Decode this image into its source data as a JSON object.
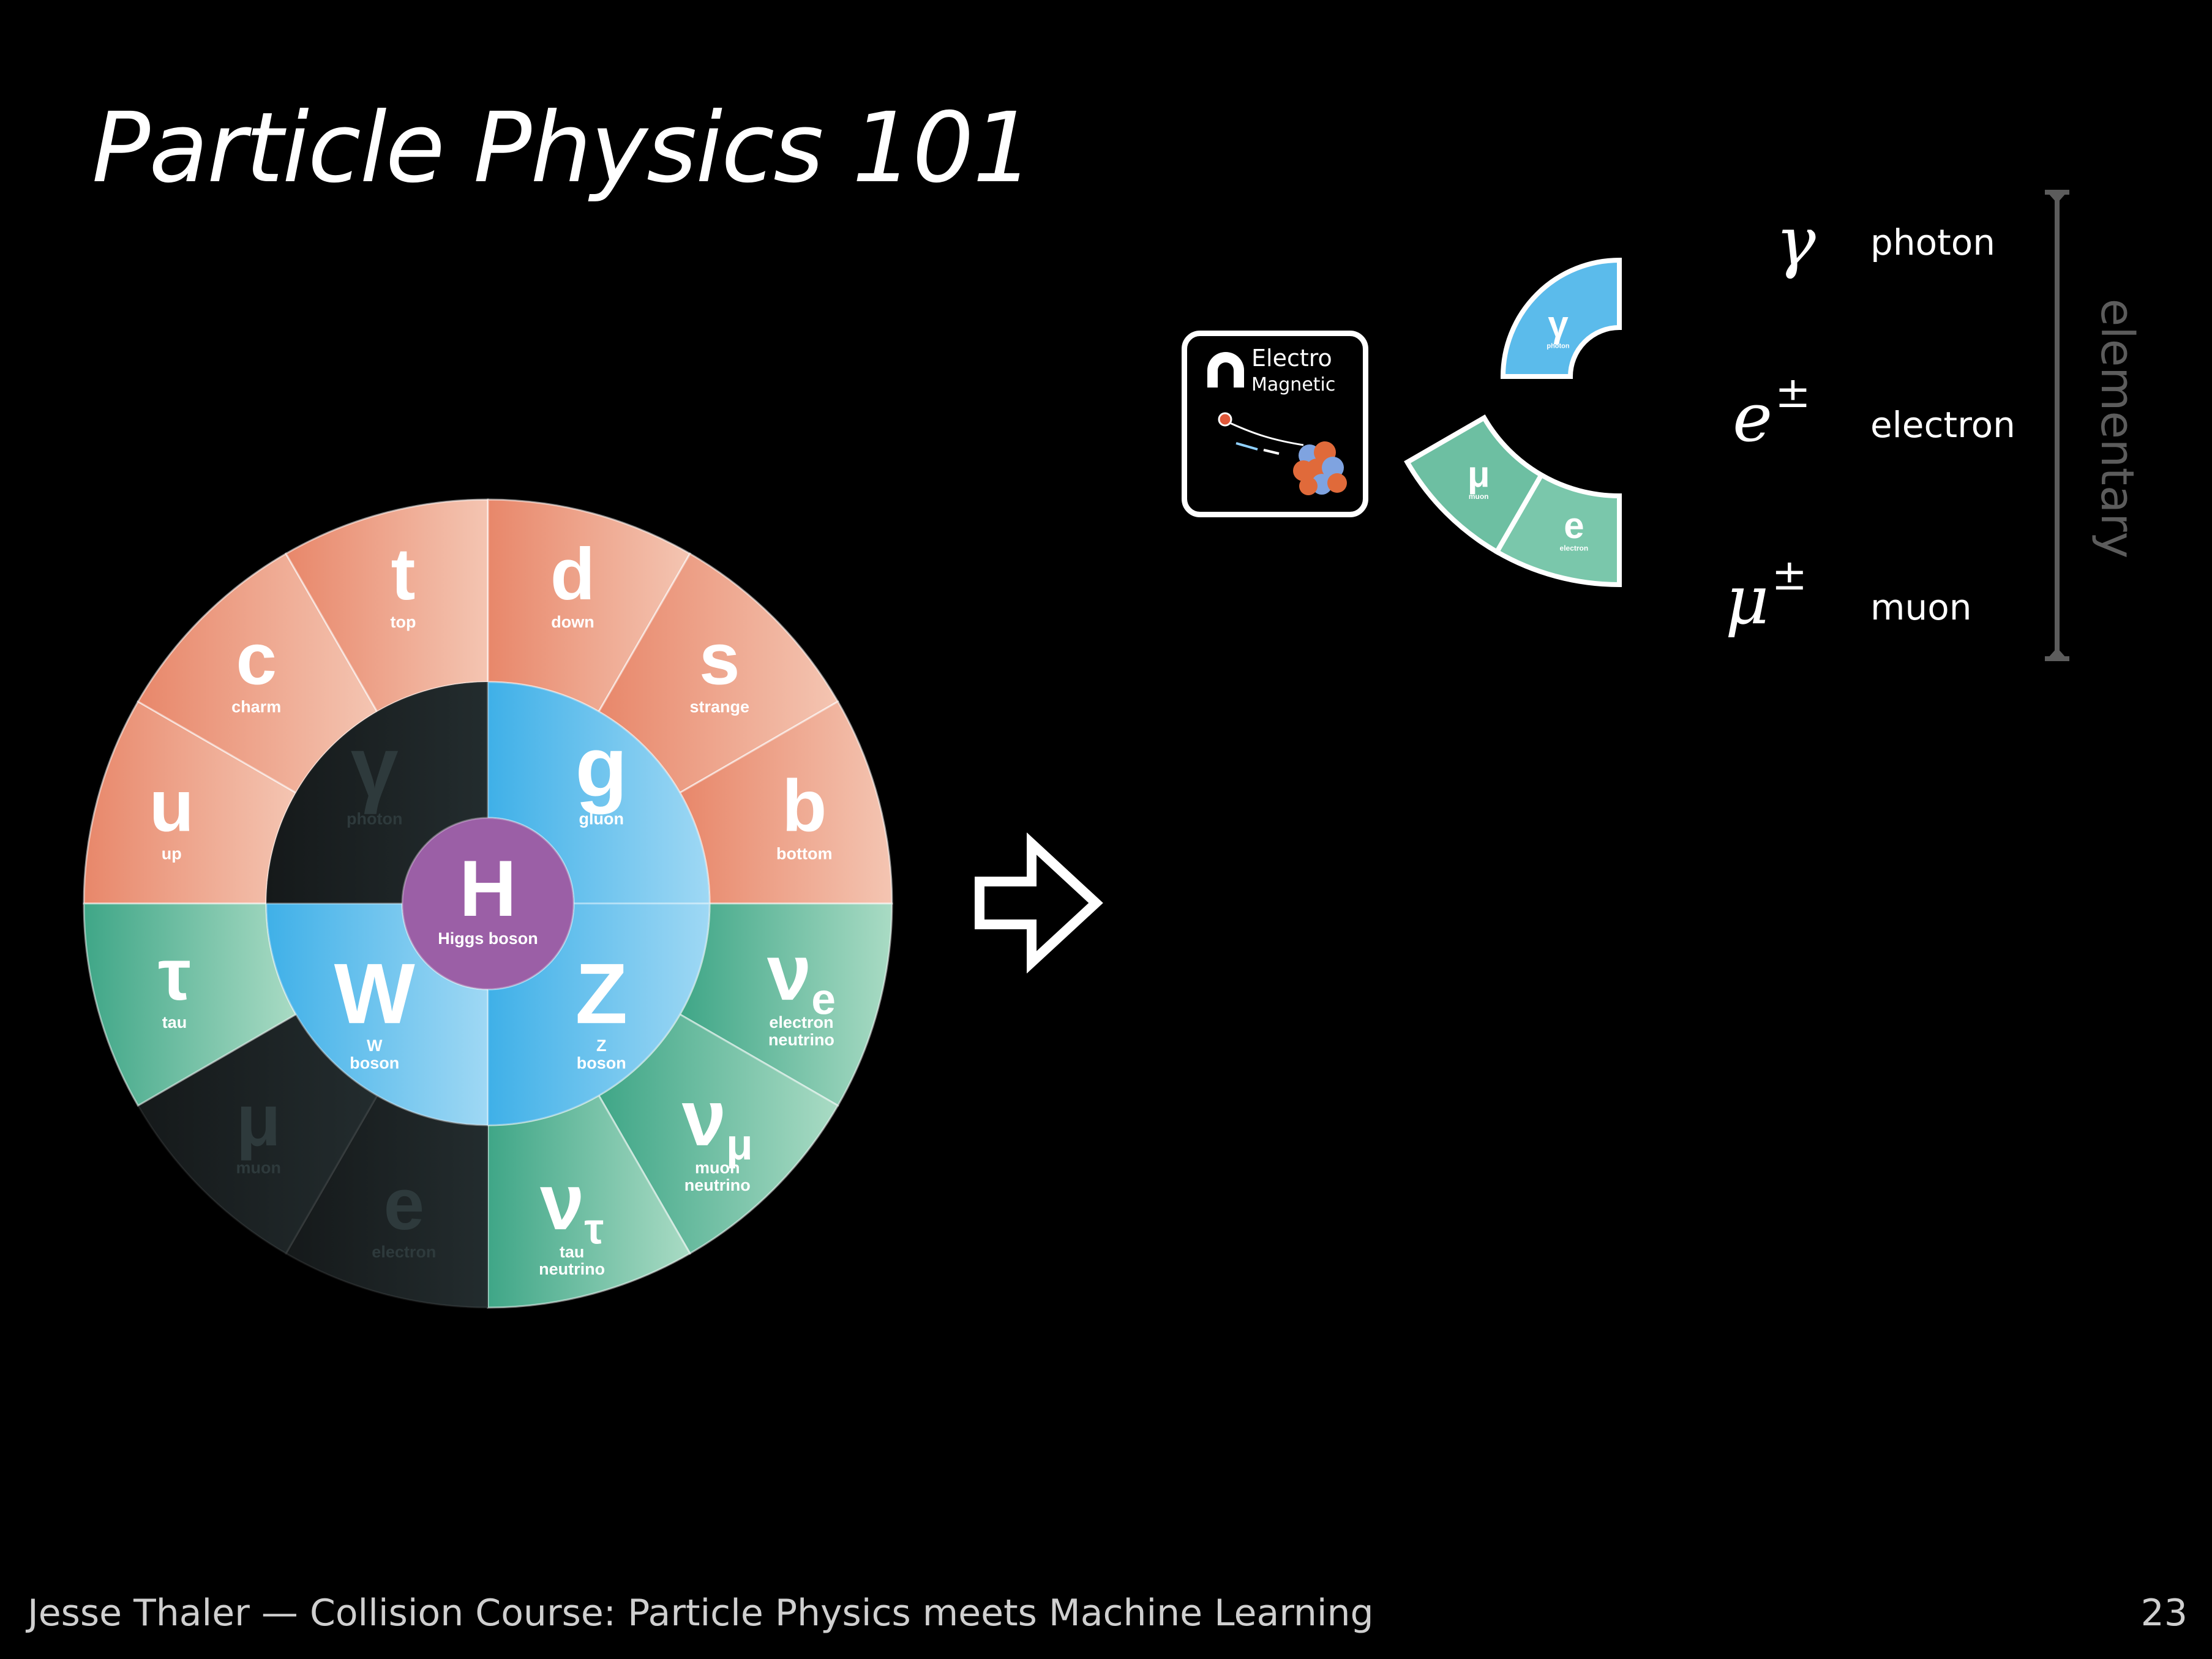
{
  "slide": {
    "title": "Particle Physics 101",
    "footer": "Jesse Thaler — Collision Course:  Particle Physics meets Machine Learning",
    "page_number": "23",
    "arrow_icon": "right-arrow-icon"
  },
  "wheel": {
    "center": {
      "symbol": "H",
      "name": "Higgs boson"
    },
    "bosons": [
      {
        "symbol": "γ",
        "name": "photon"
      },
      {
        "symbol": "g",
        "name": "gluon"
      },
      {
        "symbol": "W",
        "name": "W\nboson"
      },
      {
        "symbol": "Z",
        "name": "Z\nboson"
      }
    ],
    "quarks": [
      {
        "symbol": "u",
        "name": "up"
      },
      {
        "symbol": "c",
        "name": "charm"
      },
      {
        "symbol": "t",
        "name": "top"
      },
      {
        "symbol": "d",
        "name": "down"
      },
      {
        "symbol": "s",
        "name": "strange"
      },
      {
        "symbol": "b",
        "name": "bottom"
      }
    ],
    "leptons": [
      {
        "symbol": "ν",
        "sub": "e",
        "name": "electron\nneutrino"
      },
      {
        "symbol": "ν",
        "sub": "μ",
        "name": "muon\nneutrino"
      },
      {
        "symbol": "ν",
        "sub": "τ",
        "name": "tau\nneutrino"
      },
      {
        "symbol": "e",
        "name": "electron"
      },
      {
        "symbol": "μ",
        "name": "muon"
      },
      {
        "symbol": "τ",
        "name": "tau"
      }
    ],
    "colors": {
      "quark": "#e8876a",
      "quark_light": "#f4c5b2",
      "lepton": "#3fa687",
      "lepton_light": "#a9dbc4",
      "boson": "#3fb0e8",
      "boson_light": "#9fd8f4",
      "higgs": "#9b5fa6",
      "dim": "#1d2527",
      "dim_text": "#2e3a3c"
    }
  },
  "force_card": {
    "line1": "Electro",
    "line2": "Magnetic",
    "icon": "magnet-icon"
  },
  "mini_wheel": {
    "photon": {
      "symbol": "γ",
      "name": "photon"
    },
    "muon": {
      "symbol": "μ",
      "name": "muon"
    },
    "electron": {
      "symbol": "e",
      "name": "electron"
    }
  },
  "particle_list": {
    "rows": [
      {
        "symbol": "γ",
        "sup": "",
        "name": "photon"
      },
      {
        "symbol": "e",
        "sup": "±",
        "name": "electron"
      },
      {
        "symbol": "μ",
        "sup": "±",
        "name": "muon"
      }
    ],
    "group_label": "elementary"
  }
}
